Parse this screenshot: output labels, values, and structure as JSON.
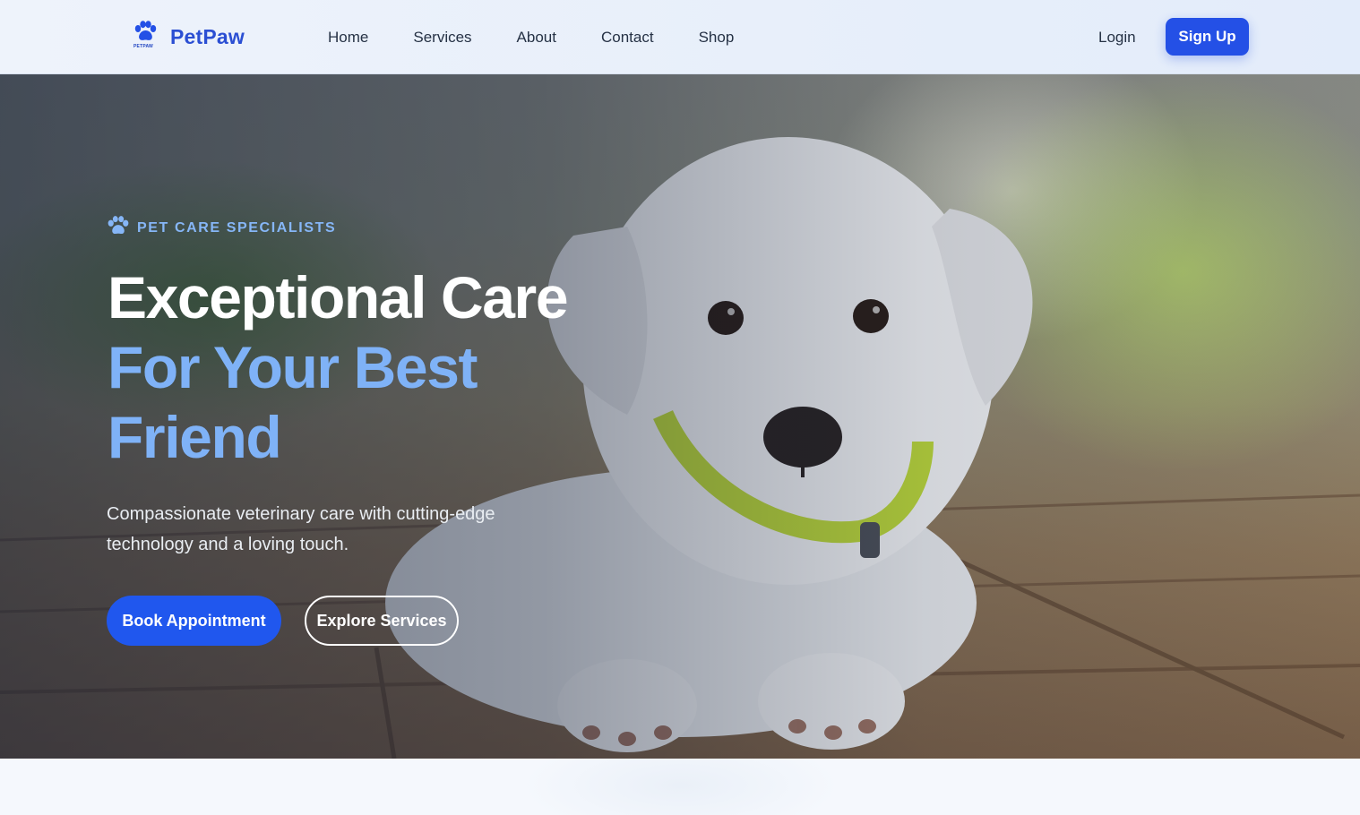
{
  "brand": {
    "name": "PetPaw",
    "logo_tagline": "PETPAW",
    "logo_icon": "paw-icon",
    "color": "#2b4fd3"
  },
  "nav": {
    "links": [
      "Home",
      "Services",
      "About",
      "Contact",
      "Shop"
    ],
    "login_label": "Login",
    "signup_label": "Sign Up"
  },
  "hero": {
    "eyebrow_icon": "paw-icon",
    "eyebrow": "PET CARE SPECIALISTS",
    "headline_line1": "Exceptional Care",
    "headline_line2": "For Your Best",
    "headline_line3": "Friend",
    "subtitle": "Compassionate veterinary care with cutting-edge technology and a loving touch.",
    "primary_cta": "Book Appointment",
    "secondary_cta": "Explore Services",
    "background_image": "white puppy with green collar lying on wooden deck"
  },
  "colors": {
    "accent": "#2450e6",
    "accent_light": "#7fb2f7",
    "text_dark": "#263245"
  }
}
